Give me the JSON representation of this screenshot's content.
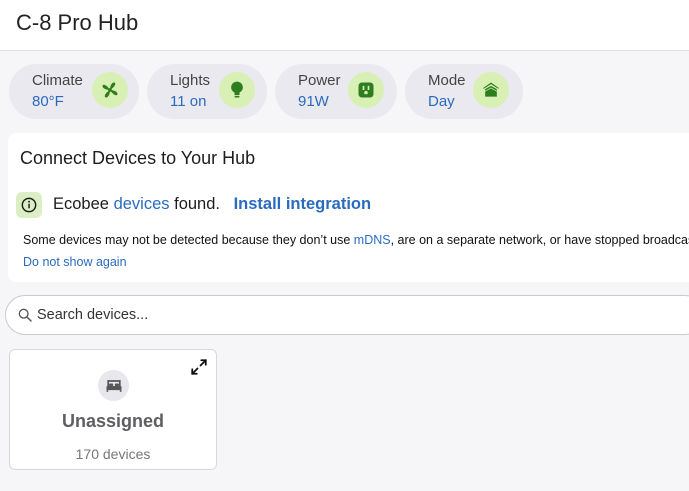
{
  "header": {
    "title": "C-8 Pro Hub"
  },
  "chips": [
    {
      "label": "Climate",
      "value": "80°F",
      "icon": "fan-icon"
    },
    {
      "label": "Lights",
      "value": "11 on",
      "icon": "lightbulb-icon"
    },
    {
      "label": "Power",
      "value": "91W",
      "icon": "power-outlet-icon"
    },
    {
      "label": "Mode",
      "value": "Day",
      "icon": "home-floor-icon"
    }
  ],
  "connect": {
    "title": "Connect Devices to Your Hub",
    "brand": "Ecobee",
    "devices_link": "devices",
    "found_text": "found.",
    "install_link": "Install integration",
    "desc_before": "Some devices may not be detected because they don’t use",
    "mdns_link": "mDNS",
    "desc_after": ", are on a separate network, or have stopped broadcasting.",
    "dont_show": "Do not show again"
  },
  "search": {
    "placeholder": "Search devices..."
  },
  "rooms": [
    {
      "name": "Unassigned",
      "count": "170 devices",
      "icon": "bed-icon"
    }
  ],
  "colors": {
    "accent": "#2a6bbf",
    "icon_bg": "#d8f0b4",
    "icon_fg": "#2e7d1e"
  }
}
